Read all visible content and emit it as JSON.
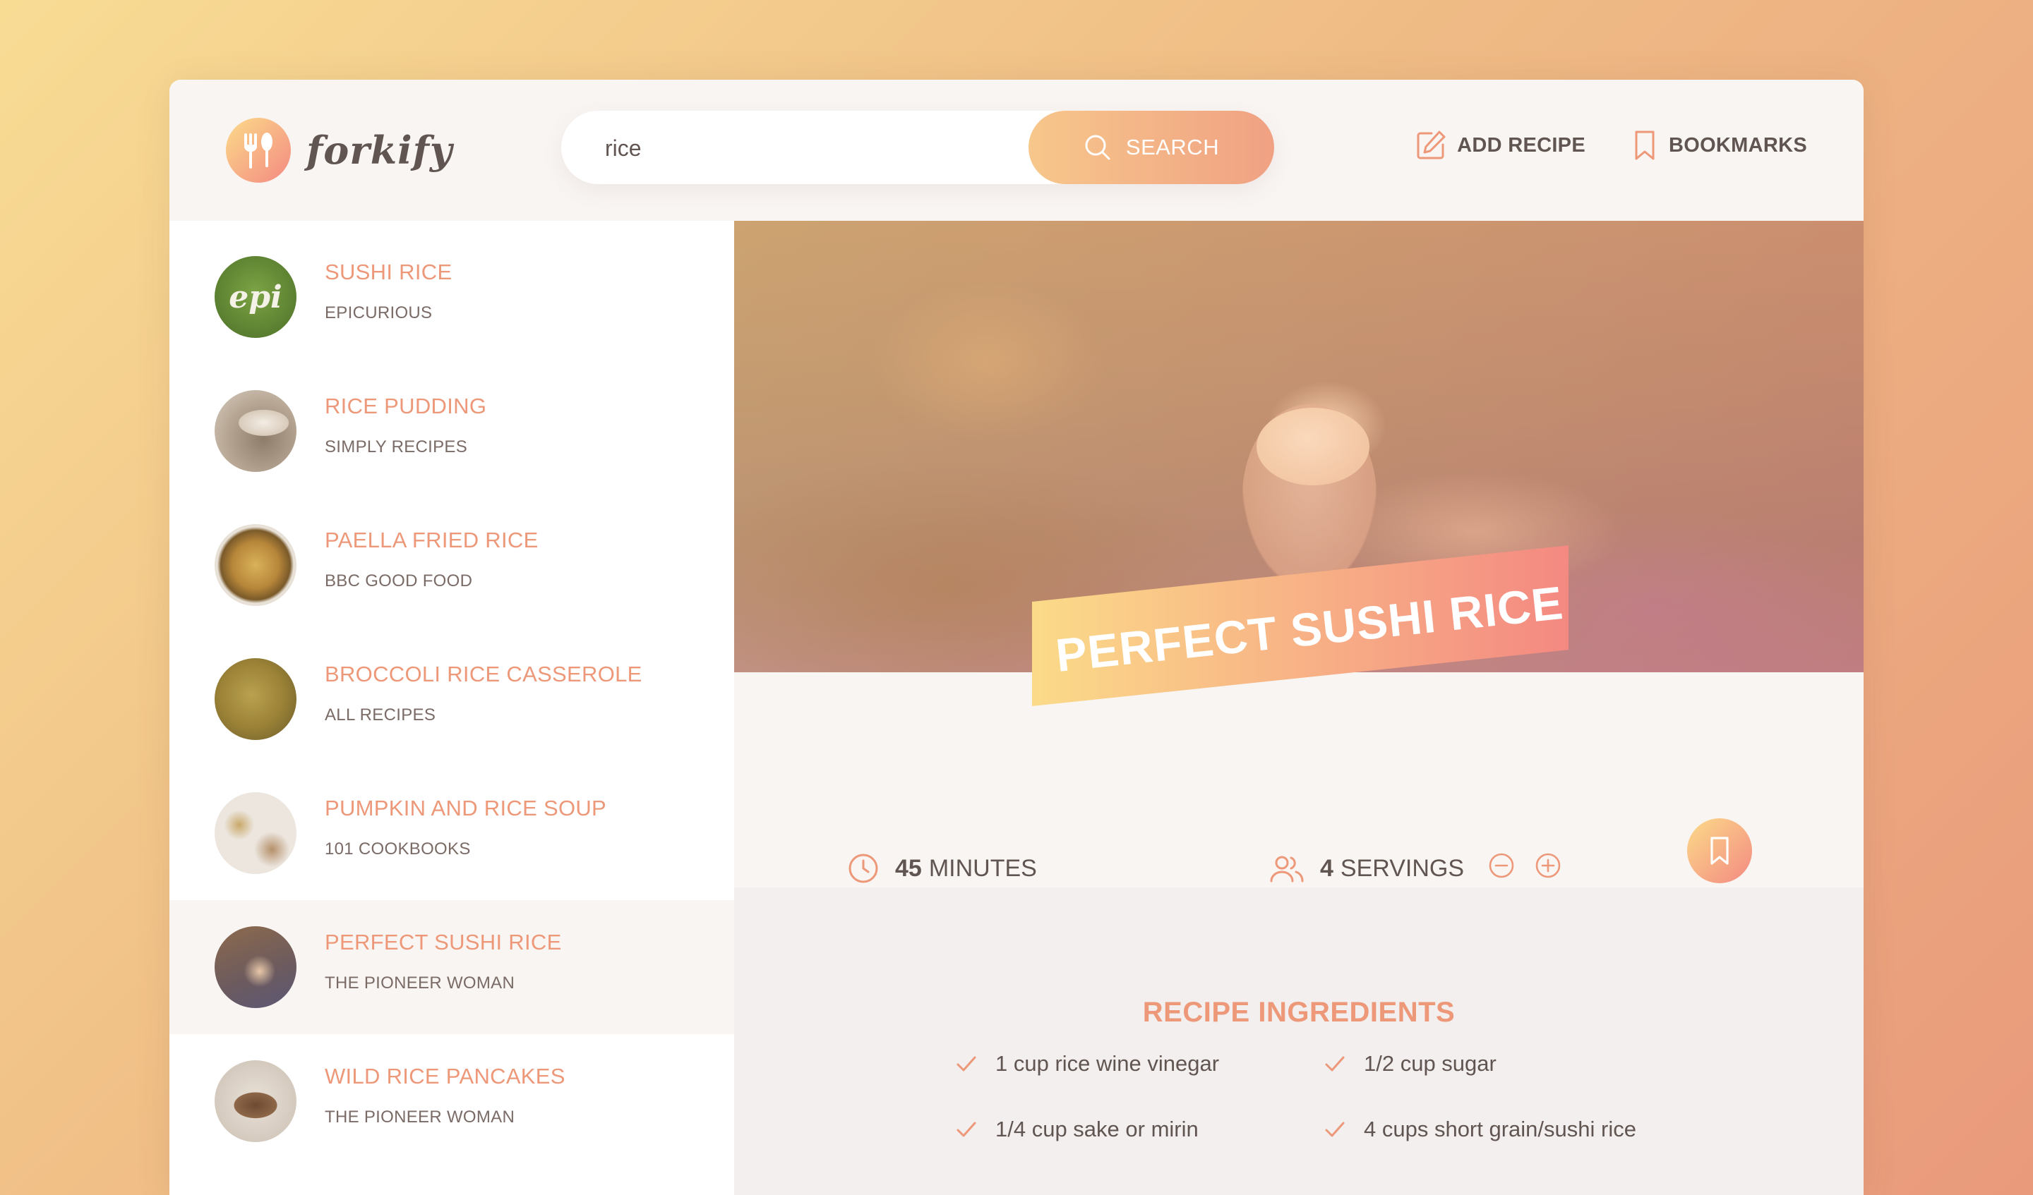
{
  "app": {
    "name": "forkify"
  },
  "search": {
    "value": "rice",
    "button_label": "SEARCH"
  },
  "nav": {
    "add_recipe": "ADD RECIPE",
    "bookmarks": "BOOKMARKS"
  },
  "results": [
    {
      "title": "SUSHI RICE",
      "publisher": "EPICURIOUS",
      "thumb_text": "epi"
    },
    {
      "title": "RICE PUDDING",
      "publisher": "SIMPLY RECIPES"
    },
    {
      "title": "PAELLA FRIED RICE",
      "publisher": "BBC GOOD FOOD"
    },
    {
      "title": "BROCCOLI RICE CASSEROLE",
      "publisher": "ALL RECIPES"
    },
    {
      "title": "PUMPKIN AND RICE SOUP",
      "publisher": "101 COOKBOOKS"
    },
    {
      "title": "PERFECT SUSHI RICE",
      "publisher": "THE PIONEER WOMAN",
      "active": true
    },
    {
      "title": "WILD RICE PANCAKES",
      "publisher": "THE PIONEER WOMAN"
    }
  ],
  "recipe": {
    "title": "PERFECT SUSHI RICE",
    "cooking_time": "45",
    "cooking_time_unit": "MINUTES",
    "servings": "4",
    "servings_unit": "SERVINGS",
    "ingredients_heading": "RECIPE INGREDIENTS",
    "ingredients": [
      "1 cup rice wine vinegar",
      "1/2 cup sugar",
      "1/4 cup sake or mirin",
      "4 cups short grain/sushi rice"
    ]
  },
  "colors": {
    "accent": "#ed9879",
    "gradient_start": "#fbdb89",
    "gradient_end": "#f48982",
    "text": "#615551"
  }
}
